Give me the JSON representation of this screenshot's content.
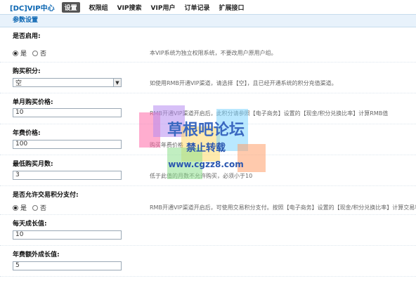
{
  "header": {
    "title": "[DC]VIP中心",
    "tabs": [
      {
        "label": "设置",
        "active": true
      },
      {
        "label": "权限组"
      },
      {
        "label": "VIP搜索"
      },
      {
        "label": "VIP用户"
      },
      {
        "label": "订单记录"
      },
      {
        "label": "扩展接口"
      }
    ]
  },
  "section": {
    "title": "参数设置"
  },
  "fields": {
    "enabled": {
      "label": "是否启用:",
      "opt_yes": "是",
      "opt_no": "否",
      "hint": "本VIP系统为独立权限系统，不要改用户原用户组。"
    },
    "buy_points": {
      "label": "购买积分:",
      "value": "空",
      "hint": "如使用RMB开通VIP渠道，请选择【空】，且已经开通系统的积分充值渠道。"
    },
    "monthly_price": {
      "label": "单月购买价格:",
      "value": "10",
      "hint": "RMB开通VIP渠道开启后，此积分请参照【电子商务】设置的【现金/积分兑换比率】计算RMB值"
    },
    "annual_price": {
      "label": "年费价格:",
      "value": "100",
      "hint": "购买年费价格"
    },
    "min_months": {
      "label": "最低购买月数:",
      "value": "3",
      "hint": "低于此值的月数不允许购买，必须小于10"
    },
    "allow_trade": {
      "label": "是否允许交易积分支付:",
      "opt_yes": "是",
      "opt_no": "否",
      "hint": "RMB开通VIP渠道开启后，可使用交易积分支付。按照【电子商务】设置的【现金/积分兑换比率】计算交易积分。"
    },
    "daily_growth": {
      "label": "每天成长值:",
      "value": "10"
    },
    "annual_growth": {
      "label": "年费额外成长值:",
      "value": "5"
    }
  },
  "watermark": {
    "title": "草根吧论坛",
    "subtitle": "禁止转载",
    "url": "www.cgzz8.com"
  }
}
